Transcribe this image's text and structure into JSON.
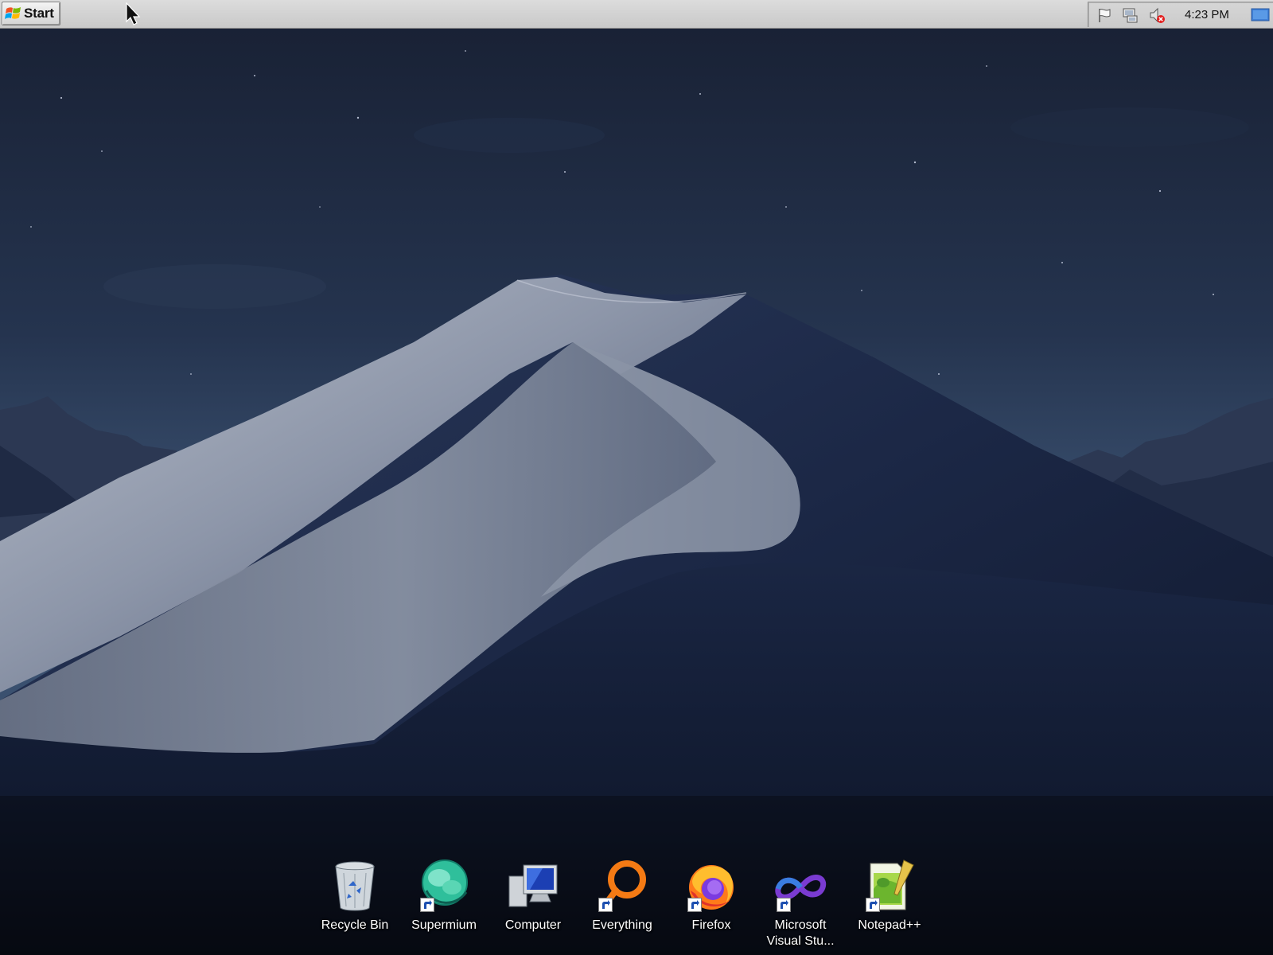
{
  "taskbar": {
    "start_label": "Start",
    "clock": "4:23 PM",
    "tray_icons": [
      "flag-icon",
      "network-icon",
      "volume-muted-icon",
      "show-desktop-icon"
    ]
  },
  "desktop": {
    "wallpaper": "night-sand-dune",
    "icons": [
      {
        "label": "Recycle Bin",
        "icon": "recycle-bin-icon",
        "shortcut": false
      },
      {
        "label": "Supermium",
        "icon": "supermium-icon",
        "shortcut": true
      },
      {
        "label": "Computer",
        "icon": "computer-icon",
        "shortcut": false
      },
      {
        "label": "Everything",
        "icon": "everything-icon",
        "shortcut": true
      },
      {
        "label": "Firefox",
        "icon": "firefox-icon",
        "shortcut": true
      },
      {
        "label": "Microsoft Visual Stu...",
        "icon": "visual-studio-icon",
        "shortcut": true
      },
      {
        "label": "Notepad++",
        "icon": "notepadpp-icon",
        "shortcut": true
      }
    ]
  },
  "colors": {
    "sky_top": "#1a2336",
    "sky_bottom": "#33486a",
    "dune_light": "#a3abbb",
    "dune_shadow": "#15203a",
    "taskbar": "#d4d4d4"
  }
}
